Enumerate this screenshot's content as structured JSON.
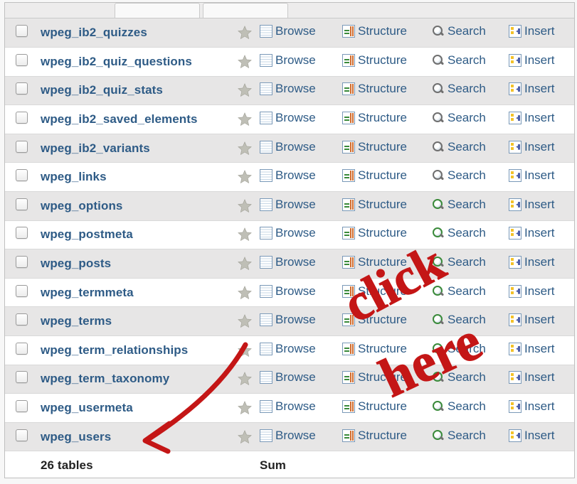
{
  "actions": {
    "browse": "Browse",
    "structure": "Structure",
    "search": "Search",
    "insert": "Insert"
  },
  "tables": [
    {
      "name": "wpeg_ib2_quizzes",
      "alt": true,
      "greenSearch": false
    },
    {
      "name": "wpeg_ib2_quiz_questions",
      "alt": false,
      "greenSearch": false
    },
    {
      "name": "wpeg_ib2_quiz_stats",
      "alt": true,
      "greenSearch": false
    },
    {
      "name": "wpeg_ib2_saved_elements",
      "alt": false,
      "greenSearch": false
    },
    {
      "name": "wpeg_ib2_variants",
      "alt": true,
      "greenSearch": false
    },
    {
      "name": "wpeg_links",
      "alt": false,
      "greenSearch": false
    },
    {
      "name": "wpeg_options",
      "alt": true,
      "greenSearch": true
    },
    {
      "name": "wpeg_postmeta",
      "alt": false,
      "greenSearch": true
    },
    {
      "name": "wpeg_posts",
      "alt": true,
      "greenSearch": true
    },
    {
      "name": "wpeg_termmeta",
      "alt": false,
      "greenSearch": true
    },
    {
      "name": "wpeg_terms",
      "alt": true,
      "greenSearch": true
    },
    {
      "name": "wpeg_term_relationships",
      "alt": false,
      "greenSearch": true
    },
    {
      "name": "wpeg_term_taxonomy",
      "alt": true,
      "greenSearch": true
    },
    {
      "name": "wpeg_usermeta",
      "alt": false,
      "greenSearch": true
    },
    {
      "name": "wpeg_users",
      "alt": true,
      "greenSearch": true
    }
  ],
  "summary": {
    "count_label": "26 tables",
    "sum_label": "Sum"
  },
  "annotation": {
    "text_line1": "click",
    "text_line2": "here"
  }
}
